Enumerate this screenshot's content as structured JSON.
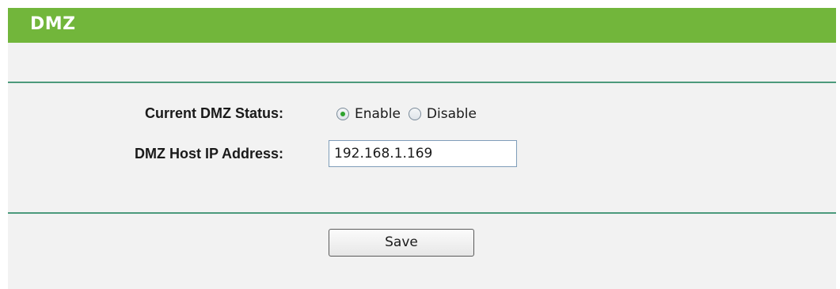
{
  "header": {
    "title": "DMZ"
  },
  "form": {
    "status_label": "Current DMZ Status:",
    "status_options": [
      {
        "label": "Enable",
        "selected": true
      },
      {
        "label": "Disable",
        "selected": false
      }
    ],
    "host_ip_label": "DMZ Host IP Address:",
    "host_ip_value": "192.168.1.169"
  },
  "actions": {
    "save_label": "Save"
  },
  "colors": {
    "title_bar": "#72b63b",
    "divider": "#4c9a7c",
    "panel_background": "#f2f2f2",
    "radio_selected": "#2fa32f"
  }
}
